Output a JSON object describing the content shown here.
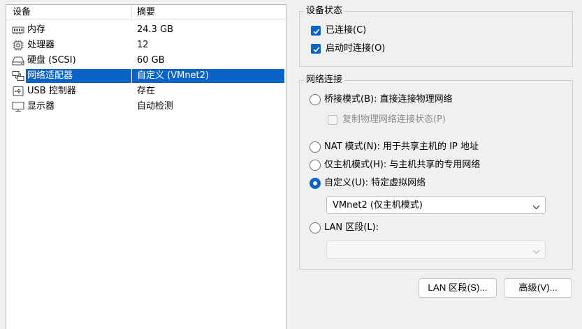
{
  "device_list": {
    "header": {
      "device": "设备",
      "summary": "摘要"
    },
    "rows": [
      {
        "name": "内存",
        "summary": "24.3 GB",
        "icon": "memory-icon"
      },
      {
        "name": "处理器",
        "summary": "12",
        "icon": "processor-icon"
      },
      {
        "name": "硬盘 (SCSI)",
        "summary": "60 GB",
        "icon": "hard-disk-icon"
      },
      {
        "name": "网络适配器",
        "summary": "自定义 (VMnet2)",
        "icon": "network-adapter-icon",
        "selected": true
      },
      {
        "name": "USB 控制器",
        "summary": "存在",
        "icon": "usb-icon"
      },
      {
        "name": "显示器",
        "summary": "自动检测",
        "icon": "monitor-icon"
      }
    ]
  },
  "device_status": {
    "title": "设备状态",
    "connected": {
      "label": "已连接(C)",
      "checked": true
    },
    "connect_at_power_on": {
      "label": "启动时连接(O)",
      "checked": true
    }
  },
  "network_connection": {
    "title": "网络连接",
    "bridged": {
      "label": "桥接模式(B): 直接连接物理网络",
      "selected": false
    },
    "replicate": {
      "label": "复制物理网络连接状态(P)",
      "checked": false,
      "disabled": true
    },
    "nat": {
      "label": "NAT 模式(N): 用于共享主机的 IP 地址",
      "selected": false
    },
    "host_only": {
      "label": "仅主机模式(H): 与主机共享的专用网络",
      "selected": false
    },
    "custom": {
      "label": "自定义(U): 特定虚拟网络",
      "selected": true
    },
    "custom_network_value": "VMnet2 (仅主机模式)",
    "lan_segment": {
      "label": "LAN 区段(L):",
      "selected": false
    },
    "lan_segment_value": ""
  },
  "buttons": {
    "lan_segments": "LAN 区段(S)...",
    "advanced": "高级(V)..."
  },
  "colors": {
    "selection": "#0a64c8",
    "background": "#f0f0f0"
  }
}
